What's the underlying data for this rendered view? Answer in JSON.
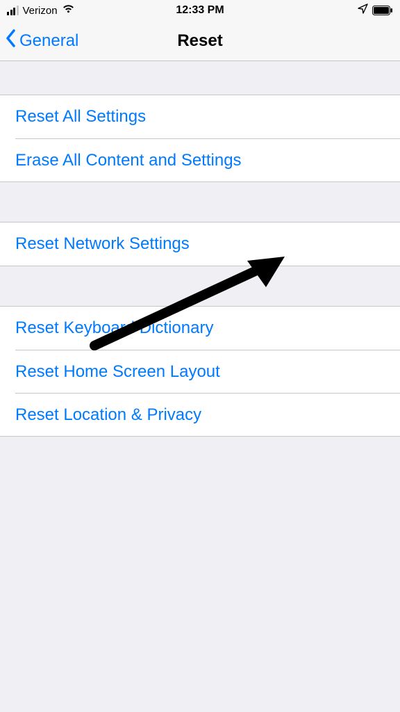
{
  "status": {
    "carrier": "Verizon",
    "time": "12:33 PM"
  },
  "nav": {
    "back_label": "General",
    "title": "Reset"
  },
  "groups": {
    "g1": {
      "item1": "Reset All Settings",
      "item2": "Erase All Content and Settings"
    },
    "g2": {
      "item1": "Reset Network Settings"
    },
    "g3": {
      "item1": "Reset Keyboard Dictionary",
      "item2": "Reset Home Screen Layout",
      "item3": "Reset Location & Privacy"
    }
  }
}
